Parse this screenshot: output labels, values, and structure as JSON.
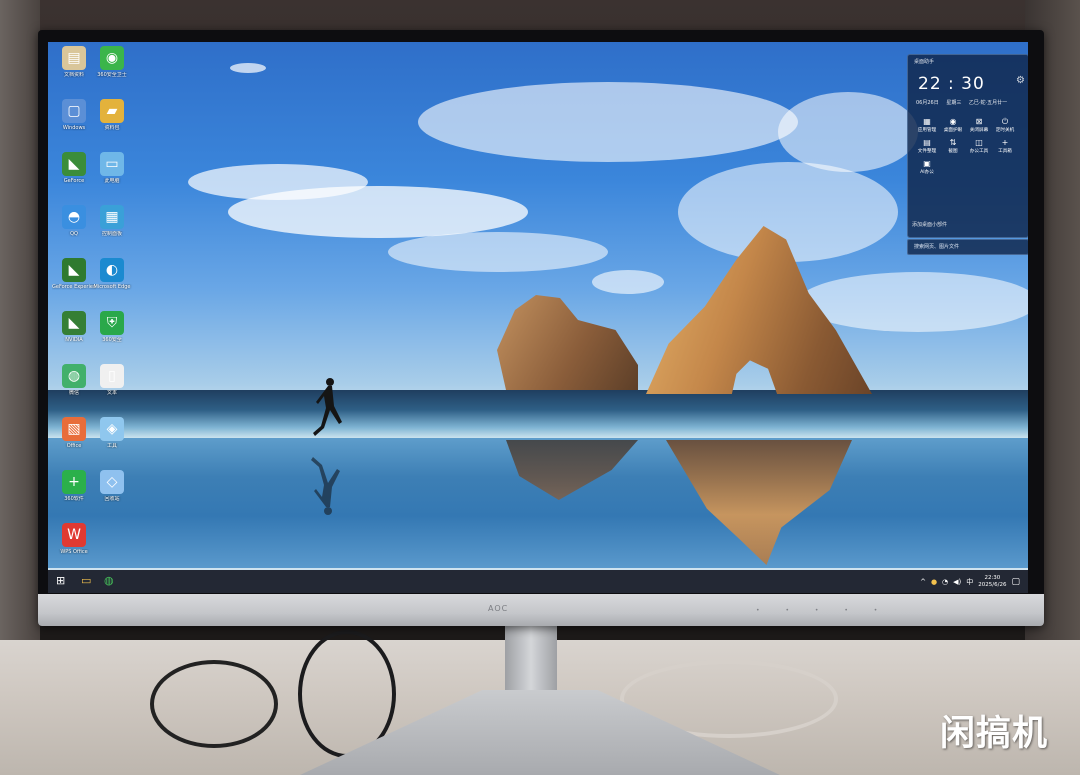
{
  "desktop_icons": [
    {
      "label": "文档资料",
      "icon": "file-icon",
      "color": "#d9c69a"
    },
    {
      "label": "360安全卫士",
      "icon": "shield-green-icon",
      "color": "#3bb54a"
    },
    {
      "label": "Windows",
      "icon": "window-icon",
      "color": "#5b8fd6"
    },
    {
      "label": "资料包",
      "icon": "folder-icon",
      "color": "#e3b23c"
    },
    {
      "label": "GeForce",
      "icon": "nvidia-icon",
      "color": "#3b8d3a"
    },
    {
      "label": "此电脑",
      "icon": "computer-icon",
      "color": "#6fb7e8"
    },
    {
      "label": "QQ",
      "icon": "qq-icon",
      "color": "#3a8fe0"
    },
    {
      "label": "控制面板",
      "icon": "panel-icon",
      "color": "#3aa0d8"
    },
    {
      "label": "GeForce Experience",
      "icon": "nvidia-icon",
      "color": "#2f7a2f"
    },
    {
      "label": "Microsoft Edge",
      "icon": "edge-icon",
      "color": "#1b8ad0"
    },
    {
      "label": "NVIDIA",
      "icon": "nvidia-icon",
      "color": "#357f35"
    },
    {
      "label": "360安全",
      "icon": "shield-icon",
      "color": "#2aa84a"
    },
    {
      "label": "微信",
      "icon": "wechat-icon",
      "color": "#42b06b"
    },
    {
      "label": "文本",
      "icon": "doc-icon",
      "color": "#f0f0f0"
    },
    {
      "label": "Office",
      "icon": "office-icon",
      "color": "#e86d3a"
    },
    {
      "label": "工具",
      "icon": "tool-icon",
      "color": "#8fc7ee"
    },
    {
      "label": "360软件",
      "icon": "plus-icon",
      "color": "#2bb04a"
    },
    {
      "label": "回收站",
      "icon": "recycle-icon",
      "color": "#8fc1ef"
    },
    {
      "label": "WPS Office",
      "icon": "wps-icon",
      "color": "#e03a32"
    }
  ],
  "widget": {
    "title": "桌面助手",
    "time": "22 : 30",
    "date": "06月26日 星期三 乙巳·蛇·五月廿一",
    "shortcuts": [
      {
        "label": "应用管理",
        "glyph": "▦"
      },
      {
        "label": "桌面护眼",
        "glyph": "◉"
      },
      {
        "label": "关闭屏幕",
        "glyph": "⊠"
      },
      {
        "label": "定时关机",
        "glyph": "⏻"
      },
      {
        "label": "文件整理",
        "glyph": "▤"
      },
      {
        "label": "截图",
        "glyph": "⇅"
      },
      {
        "label": "办公工具",
        "glyph": "◫"
      },
      {
        "label": "工具箱",
        "glyph": "+"
      },
      {
        "label": "AI办公",
        "glyph": "▣"
      }
    ],
    "add_label": "添加桌面小部件",
    "search_placeholder": "搜索网页、图片文件"
  },
  "taskbar": {
    "start": "⊞",
    "explorer": "▭",
    "app3": "◍",
    "tray_chevron": "^",
    "tray_ime": "中",
    "clock_time": "22:30",
    "clock_date": "2025/6/26",
    "notification": "▢"
  },
  "monitor": {
    "brand": "AOC"
  },
  "watermark": "闲搞机"
}
